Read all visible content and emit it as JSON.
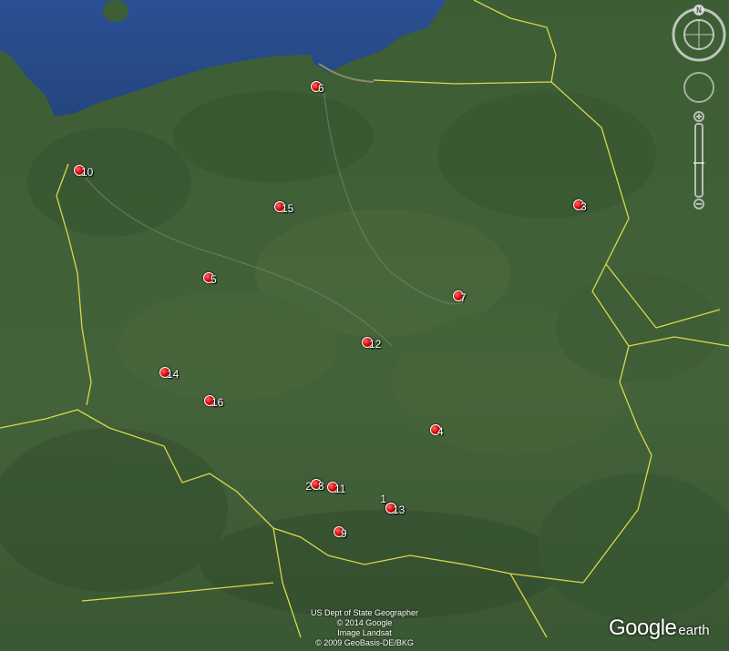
{
  "markers": [
    {
      "id": "1",
      "label": "1"
    },
    {
      "id": "2",
      "label": "2"
    },
    {
      "id": "3",
      "label": "3"
    },
    {
      "id": "4",
      "label": "4"
    },
    {
      "id": "5",
      "label": "5"
    },
    {
      "id": "6",
      "label": "6"
    },
    {
      "id": "7",
      "label": "7"
    },
    {
      "id": "8",
      "label": "8"
    },
    {
      "id": "9",
      "label": "9"
    },
    {
      "id": "10",
      "label": "10"
    },
    {
      "id": "11",
      "label": "11"
    },
    {
      "id": "12",
      "label": "12"
    },
    {
      "id": "13",
      "label": "13"
    },
    {
      "id": "14",
      "label": "14"
    },
    {
      "id": "15",
      "label": "15"
    },
    {
      "id": "16",
      "label": "16"
    }
  ],
  "attribution": {
    "line1": "US Dept of State Geographer",
    "line2": "© 2014 Google",
    "line3": "Image Landsat",
    "line4": "© 2009 GeoBasis-DE/BKG"
  },
  "logo": {
    "google": "Google",
    "earth": "earth"
  },
  "compass": {
    "north": "N"
  },
  "colors": {
    "marker": "#d40000",
    "sea": "#2a4f8f",
    "border": "#d8d84a",
    "land": "#3b5a34"
  },
  "icons": {
    "marker": "placemark-icon",
    "compass": "compass-icon",
    "zoom": "zoom-slider-icon"
  }
}
